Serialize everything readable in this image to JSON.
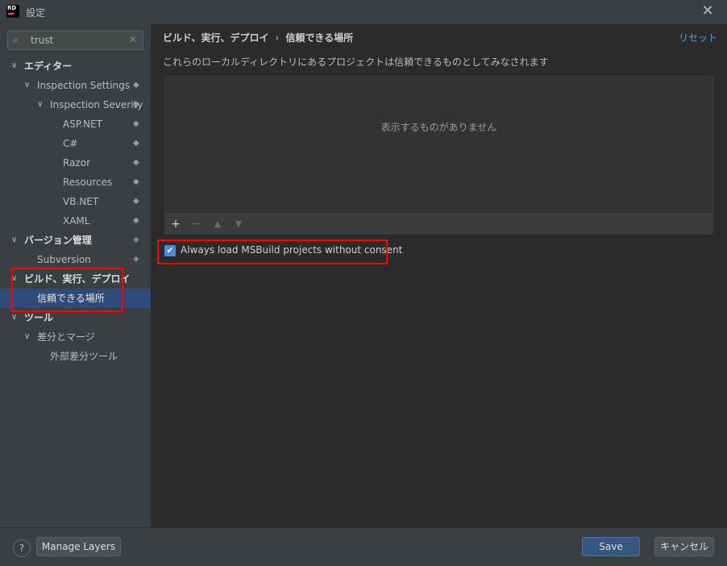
{
  "window": {
    "title": "設定",
    "app_badge": "RD"
  },
  "search": {
    "value": "trust"
  },
  "tree": [
    {
      "label": "エディター",
      "arrow": "v",
      "bold": true
    },
    {
      "label": "Inspection Settings",
      "arrow": "v",
      "marker": "layers"
    },
    {
      "label": "Inspection Severity",
      "arrow": "v",
      "marker": "layers"
    },
    {
      "label": "ASP.NET",
      "marker": "layers"
    },
    {
      "label": "C#",
      "marker": "layers"
    },
    {
      "label": "Razor",
      "marker": "layers"
    },
    {
      "label": "Resources",
      "marker": "layers"
    },
    {
      "label": "VB.NET",
      "marker": "layers"
    },
    {
      "label": "XAML",
      "marker": "layers"
    },
    {
      "label": "バージョン管理",
      "arrow": "v",
      "bold": true,
      "marker": "vcs"
    },
    {
      "label": "Subversion",
      "marker": "vcs"
    },
    {
      "label": "ビルド、実行、デプロイ",
      "arrow": "v",
      "bold": true
    },
    {
      "label": "信頼できる場所",
      "selected": true
    },
    {
      "label": "ツール",
      "arrow": "v",
      "bold": true
    },
    {
      "label": "差分とマージ",
      "arrow": "v"
    },
    {
      "label": "外部差分ツール"
    }
  ],
  "main": {
    "breadcrumb": [
      "ビルド、実行、デプロイ",
      "信頼できる場所"
    ],
    "breadcrumb_sep": "›",
    "reset_label": "リセット",
    "description": "これらのローカルディレクトリにあるプロジェクトは信頼できるものとしてみなされます",
    "empty_text": "表示するものがありません",
    "toolbar": [
      "+",
      "−",
      "▲",
      "▼"
    ],
    "checkbox_label": "Always load MSBuild projects without consent",
    "checkbox_checked": true
  },
  "footer": {
    "help_label": "?",
    "manage_layers_label": "Manage Layers",
    "save_label": "Save",
    "cancel_label": "キャンセル"
  },
  "colors": {
    "selection": "#2f4b78",
    "highlight_box": "#ff0000",
    "primary_button": "#365880",
    "link": "#5a9bdc"
  }
}
